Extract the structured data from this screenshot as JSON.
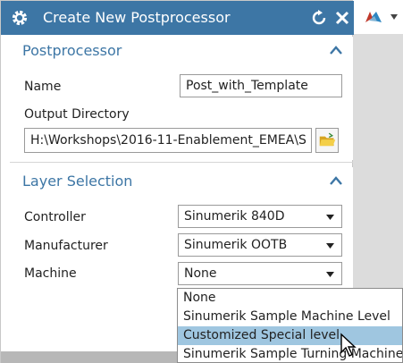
{
  "dialog": {
    "title": "Create New Postprocessor",
    "accent_color": "#3d76a5",
    "icons": [
      "gear-icon",
      "reset-icon",
      "close-icon"
    ]
  },
  "postprocessor": {
    "section_title": "Postprocessor",
    "name_label": "Name",
    "name_value": "Post_with_Template",
    "output_dir_label": "Output Directory",
    "output_dir_value": "H:\\Workshops\\2016-11-Enablement_EMEA\\S"
  },
  "layer_selection": {
    "section_title": "Layer Selection",
    "controller_label": "Controller",
    "controller_value": "Sinumerik 840D",
    "manufacturer_label": "Manufacturer",
    "manufacturer_value": "Sinumerik OOTB",
    "machine_label": "Machine",
    "machine_value": "None"
  },
  "machine_dropdown": {
    "options": [
      "None",
      "Sinumerik Sample Machine Level",
      "Customized Special level",
      "Sinumerik Sample Turning Machine"
    ],
    "highlighted_index": 2
  }
}
